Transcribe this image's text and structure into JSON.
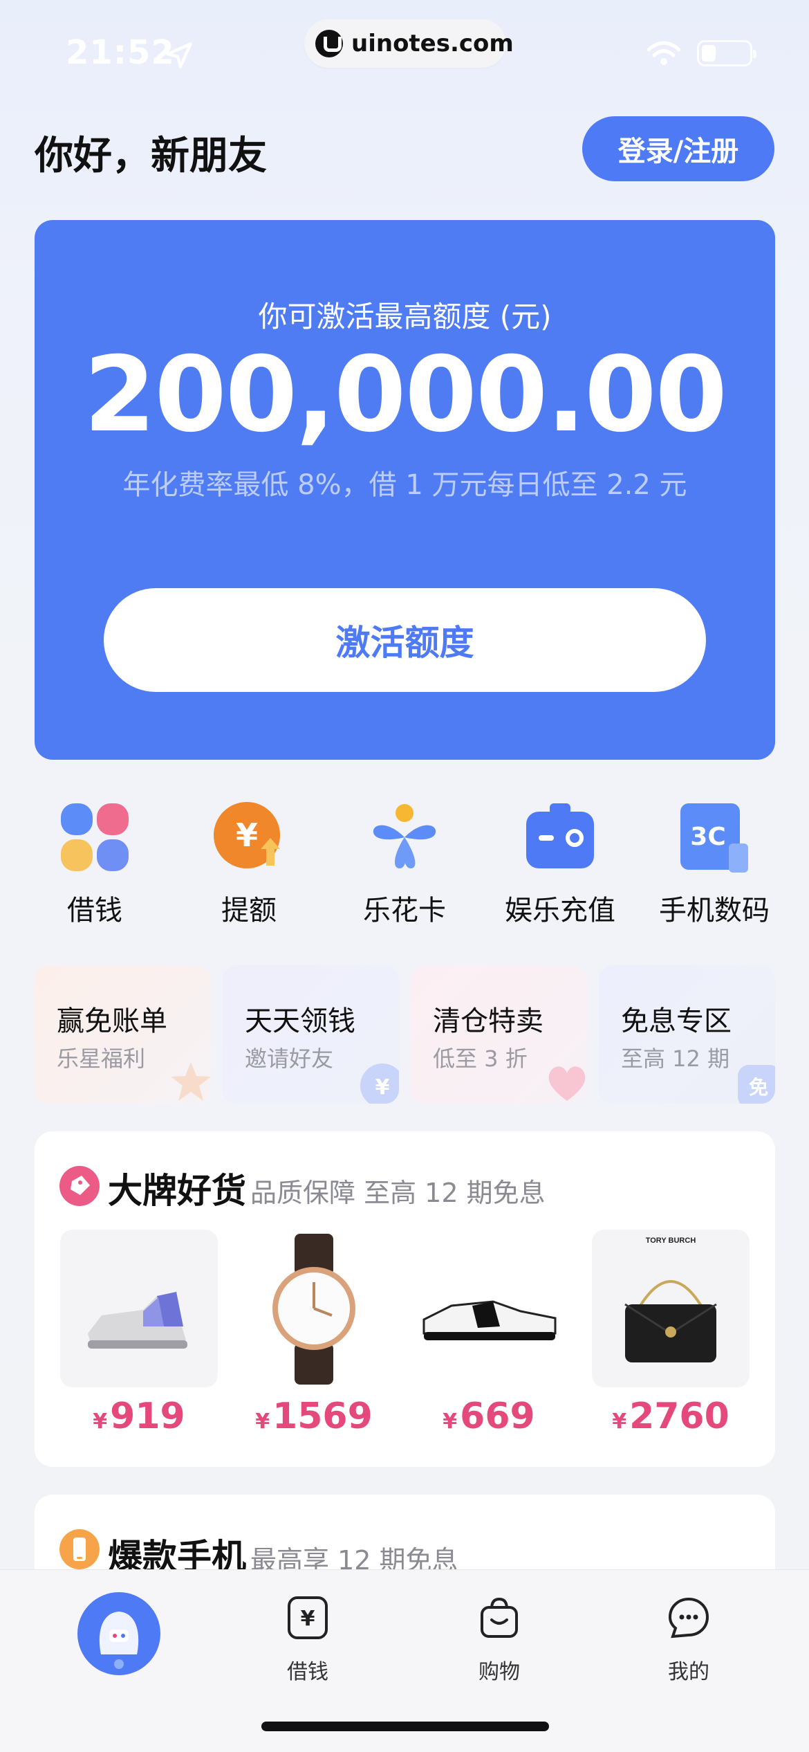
{
  "status_bar": {
    "time": "21:52",
    "url": "uinotes.com"
  },
  "header": {
    "greeting": "你好，新朋友",
    "login_label": "登录/注册"
  },
  "quota_card": {
    "label": "你可激活最高额度 (元)",
    "amount": "200,000.00",
    "desc": "年化费率最低 8%，借 1 万元每日低至 2.2 元",
    "activate_label": "激活额度"
  },
  "quick_items": [
    {
      "label": "借钱",
      "icon": "clover-icon"
    },
    {
      "label": "提额",
      "icon": "yen-up-icon"
    },
    {
      "label": "乐花卡",
      "icon": "flower-card-icon"
    },
    {
      "label": "娱乐充值",
      "icon": "ticket-icon"
    },
    {
      "label": "手机数码",
      "icon": "3c-icon"
    }
  ],
  "promos": [
    {
      "title": "赢免账单",
      "sub": "乐星福利"
    },
    {
      "title": "天天领钱",
      "sub": "邀请好友"
    },
    {
      "title": "清仓特卖",
      "sub": "低至 3 折"
    },
    {
      "title": "免息专区",
      "sub": "至高 12 期"
    }
  ],
  "brand_section": {
    "title": "大牌好货",
    "sub": "品质保障 至高 12 期免息",
    "currency": "¥",
    "products": [
      {
        "price": "919",
        "icon": "sneaker-icon"
      },
      {
        "price": "1569",
        "icon": "watch-icon"
      },
      {
        "price": "669",
        "icon": "shoe-icon"
      },
      {
        "price": "2760",
        "icon": "handbag-icon",
        "brand_text": "TORY BURCH"
      }
    ]
  },
  "phones_section": {
    "title": "爆款手机",
    "sub": "最高享 12 期免息"
  },
  "tab_bar": {
    "tabs": [
      {
        "label": "借钱",
        "icon": "yen-doc-icon"
      },
      {
        "label": "购物",
        "icon": "bag-icon"
      },
      {
        "label": "我的",
        "icon": "chat-face-icon"
      }
    ]
  },
  "colors": {
    "accent": "#4F7AF5",
    "price": "#E5487A"
  }
}
